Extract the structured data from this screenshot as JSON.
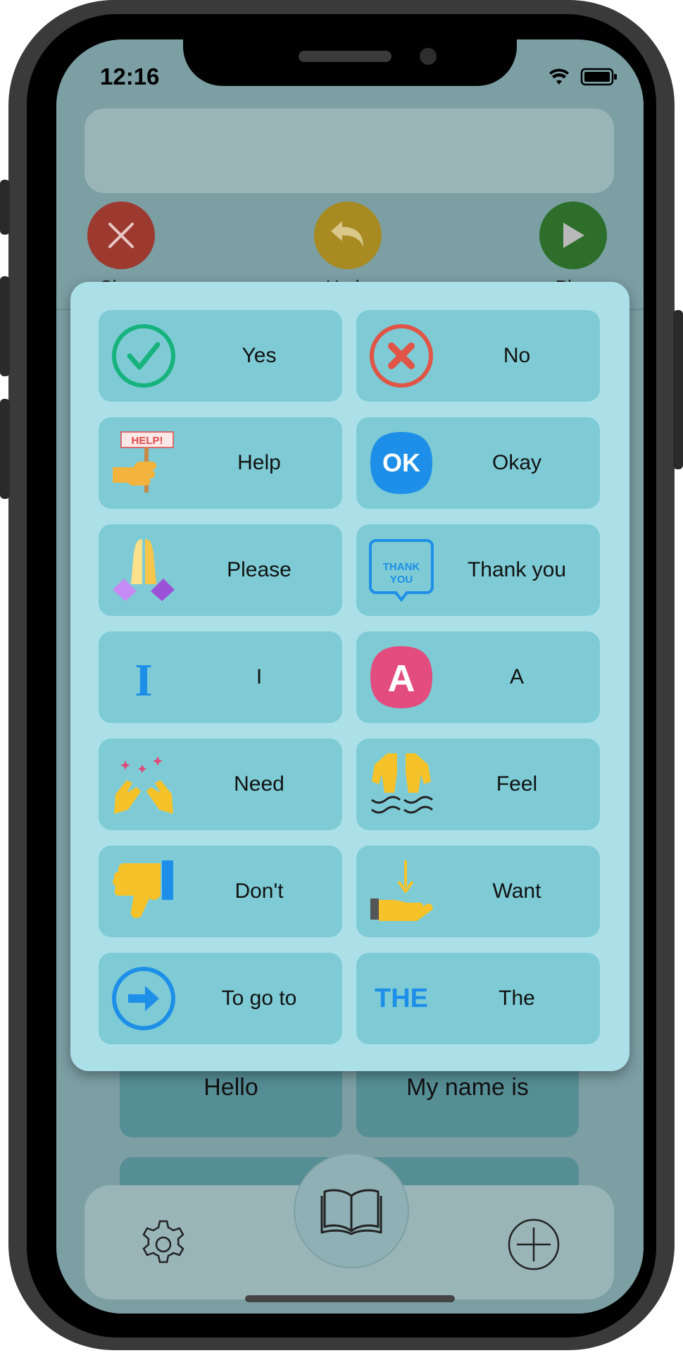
{
  "status_bar": {
    "time": "12:16"
  },
  "action_buttons": {
    "clear": {
      "label": "Clear",
      "color": "#9d3a30"
    },
    "undo": {
      "label": "Undo",
      "color": "#a78a22"
    },
    "play": {
      "label": "Play",
      "color": "#2c6e2a"
    }
  },
  "background_tiles": [
    {
      "label": "Hello"
    },
    {
      "label": "My name is"
    }
  ],
  "popup": {
    "tiles": [
      {
        "label": "Yes",
        "icon": "check-circle-icon"
      },
      {
        "label": "No",
        "icon": "x-circle-icon"
      },
      {
        "label": "Help",
        "icon": "help-sign-icon",
        "icon_text": "HELP!"
      },
      {
        "label": "Okay",
        "icon": "ok-badge-icon",
        "icon_text": "OK"
      },
      {
        "label": "Please",
        "icon": "praying-hands-icon"
      },
      {
        "label": "Thank you",
        "icon": "thank-you-bubble-icon",
        "icon_text": "THANK YOU"
      },
      {
        "label": "I",
        "icon": "letter-i-icon",
        "icon_text": "I"
      },
      {
        "label": "A",
        "icon": "letter-a-icon",
        "icon_text": "A"
      },
      {
        "label": "Need",
        "icon": "raising-hands-icon"
      },
      {
        "label": "Feel",
        "icon": "hands-feel-icon"
      },
      {
        "label": "Don't",
        "icon": "thumbs-down-icon"
      },
      {
        "label": "Want",
        "icon": "open-hand-receive-icon"
      },
      {
        "label": "To go to",
        "icon": "arrow-circle-icon"
      },
      {
        "label": "The",
        "icon": "the-word-icon",
        "icon_text": "THE"
      }
    ]
  },
  "tabbar": {
    "settings_icon": "gear-icon",
    "library_icon": "book-icon",
    "add_icon": "plus-circle-icon"
  }
}
